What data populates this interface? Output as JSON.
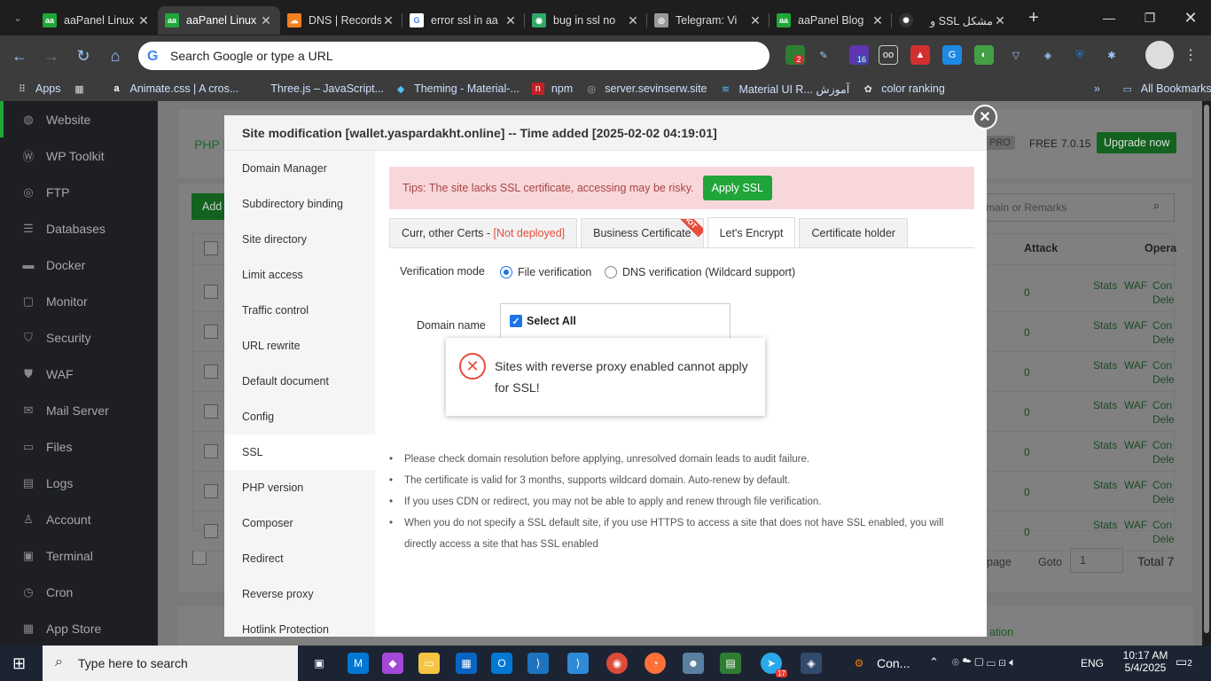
{
  "browser": {
    "tabs": [
      {
        "label": "aaPanel Linux",
        "icon_color": "#20a53a"
      },
      {
        "label": "aaPanel Linux",
        "icon_color": "#20a53a"
      },
      {
        "label": "DNS | Records",
        "icon_color": "#f38020"
      },
      {
        "label": "error ssl in aa",
        "icon_color": "#4285f4"
      },
      {
        "label": "bug in ssl no",
        "icon_color": "#2fa86a"
      },
      {
        "label": "Telegram: Vi",
        "icon_color": "#999999"
      },
      {
        "label": "aaPanel Blog",
        "icon_color": "#20a53a"
      },
      {
        "label": "مشکل SSL و",
        "icon_color": "#333333"
      }
    ],
    "address_placeholder": "Search Google or type a URL",
    "bookmarks": [
      {
        "label": "Apps",
        "icon": "apps-grid-icon"
      },
      {
        "label": "Animate.css | A cros...",
        "icon": "animate-icon"
      },
      {
        "label": "Three.js – JavaScript...",
        "icon": "threejs-icon"
      },
      {
        "label": "Theming - Material-...",
        "icon": "material-icon"
      },
      {
        "label": "npm",
        "icon": "npm-icon"
      },
      {
        "label": "server.sevinserw.site",
        "icon": "globe-icon"
      },
      {
        "label": "Material UI R... آموزش",
        "icon": "mui-icon"
      },
      {
        "label": "color ranking",
        "icon": "palette-icon"
      }
    ],
    "all_bookmarks": "All Bookmarks",
    "badge_ext": "2",
    "badge_ext2": "16"
  },
  "sidebar": {
    "items": [
      {
        "label": "Website",
        "icon": "globe-icon"
      },
      {
        "label": "WP Toolkit",
        "icon": "wordpress-icon"
      },
      {
        "label": "FTP",
        "icon": "ftp-icon"
      },
      {
        "label": "Databases",
        "icon": "database-icon"
      },
      {
        "label": "Docker",
        "icon": "docker-icon"
      },
      {
        "label": "Monitor",
        "icon": "monitor-icon"
      },
      {
        "label": "Security",
        "icon": "shield-icon"
      },
      {
        "label": "WAF",
        "icon": "waf-icon"
      },
      {
        "label": "Mail Server",
        "icon": "mail-icon"
      },
      {
        "label": "Files",
        "icon": "folder-icon"
      },
      {
        "label": "Logs",
        "icon": "logs-icon"
      },
      {
        "label": "Account",
        "icon": "user-icon"
      },
      {
        "label": "Terminal",
        "icon": "terminal-icon"
      },
      {
        "label": "Cron",
        "icon": "clock-icon"
      },
      {
        "label": "App Store",
        "icon": "appstore-icon"
      }
    ]
  },
  "background": {
    "php_tab": "PHP P",
    "add_btn": "Add",
    "pro": "PRO",
    "free": "FREE",
    "version": "7.0.15",
    "upgrade": "Upgrade now",
    "search_placeholder": "main or Remarks",
    "col_attack": "Attack",
    "col_ops": "Opera",
    "rows": [
      {
        "attack": "0",
        "stats": "Stats",
        "waf": "WAF",
        "con": "Con",
        "del": "Dele"
      },
      {
        "attack": "0",
        "stats": "Stats",
        "waf": "WAF",
        "con": "Con",
        "del": "Dele"
      },
      {
        "attack": "0",
        "stats": "Stats",
        "waf": "WAF",
        "con": "Con",
        "del": "Dele"
      },
      {
        "attack": "0",
        "stats": "Stats",
        "waf": "WAF",
        "con": "Con",
        "del": "Dele"
      },
      {
        "attack": "0",
        "stats": "Stats",
        "waf": "WAF",
        "con": "Con",
        "del": "Dele"
      },
      {
        "attack": "0",
        "stats": "Stats",
        "waf": "WAF",
        "con": "Con",
        "del": "Dele"
      },
      {
        "attack": "0",
        "stats": "Stats",
        "waf": "WAF",
        "con": "Con",
        "del": "Dele"
      }
    ],
    "page_label": "page",
    "goto": "Goto",
    "goto_value": "1",
    "total": "Total 7",
    "bottom_link": "ation"
  },
  "modal": {
    "title": "Site modification [wallet.yaspardakht.online] -- Time added [2025-02-02 04:19:01]",
    "nav": [
      "Domain Manager",
      "Subdirectory binding",
      "Site directory",
      "Limit access",
      "Traffic control",
      "URL rewrite",
      "Default document",
      "Config",
      "SSL",
      "PHP version",
      "Composer",
      "Redirect",
      "Reverse proxy",
      "Hotlink Protection"
    ],
    "active_nav": "SSL",
    "tips": "Tips: The site lacks SSL certificate, accessing may be risky.",
    "apply_ssl": "Apply SSL",
    "tabs": [
      {
        "label": "Curr, other Certs - ",
        "extra": "[Not deployed]"
      },
      {
        "label": "Business Certificate",
        "hot": "HOT"
      },
      {
        "label": "Let's Encrypt"
      },
      {
        "label": "Certificate holder"
      }
    ],
    "verification_label": "Verification mode",
    "file_verification": "File verification",
    "dns_verification": "DNS verification (Wildcard support)",
    "domain_label": "Domain name",
    "select_all": "Select All",
    "notes": [
      "Please check domain resolution before applying, unresolved domain leads to audit failure.",
      "The certificate is valid for 3 months, supports wildcard domain. Auto-renew by default.",
      "If you uses CDN or redirect, you may not be able to apply and renew through file verification.",
      "When you do not specify a SSL default site, if you use HTTPS to access a site that does not have SSL enabled, you will directly access a site that has SSL enabled"
    ]
  },
  "toast": {
    "message": "Sites with reverse proxy enabled cannot apply for SSL!"
  },
  "taskbar": {
    "search_placeholder": "Type here to search",
    "running_label": "Con...",
    "language": "ENG",
    "time": "10:17 AM",
    "date": "5/4/2025",
    "notif_count": "2",
    "telegram_badge": "17"
  }
}
